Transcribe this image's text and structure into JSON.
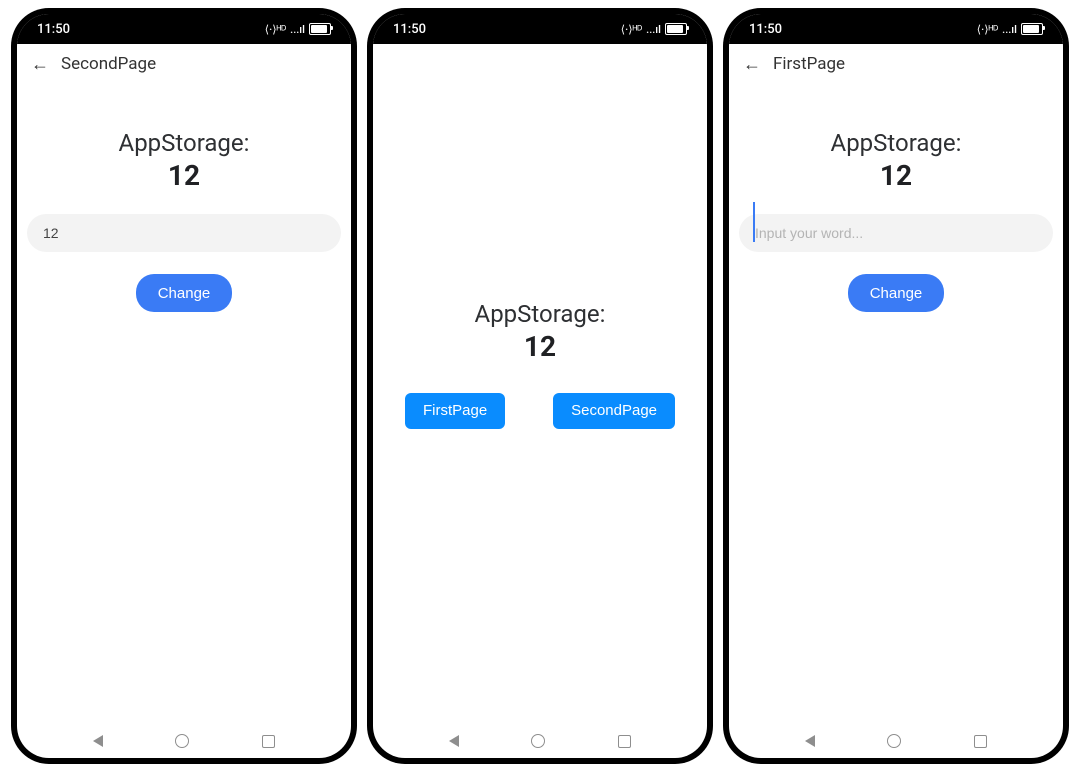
{
  "status": {
    "time": "11:50",
    "network": "⟨·⟩ᴴᴰ",
    "signal": "...ıl"
  },
  "app_title": "AppStorage:",
  "app_value": "12",
  "colors": {
    "button_blue": "#3A7BF5",
    "nav_button_blue": "#0A8CFE",
    "input_bg": "#F3F3F3",
    "text_dark": "#2E3033",
    "placeholder": "#B4B4B4"
  },
  "screens": [
    {
      "id": "second-page",
      "topbar_back": true,
      "topbar_title": "SecondPage",
      "has_input": true,
      "input_value": "12",
      "input_placeholder": "",
      "has_change_button": true,
      "change_button_label": "Change",
      "centered": false
    },
    {
      "id": "index-page",
      "topbar_back": false,
      "topbar_title": "",
      "has_input": false,
      "centered": true,
      "nav_buttons": [
        {
          "label": "FirstPage"
        },
        {
          "label": "SecondPage"
        }
      ]
    },
    {
      "id": "first-page",
      "topbar_back": true,
      "topbar_title": "FirstPage",
      "has_input": true,
      "input_value": "",
      "input_placeholder": "Input your word...",
      "input_focused": true,
      "has_change_button": true,
      "change_button_label": "Change",
      "centered": false
    }
  ]
}
